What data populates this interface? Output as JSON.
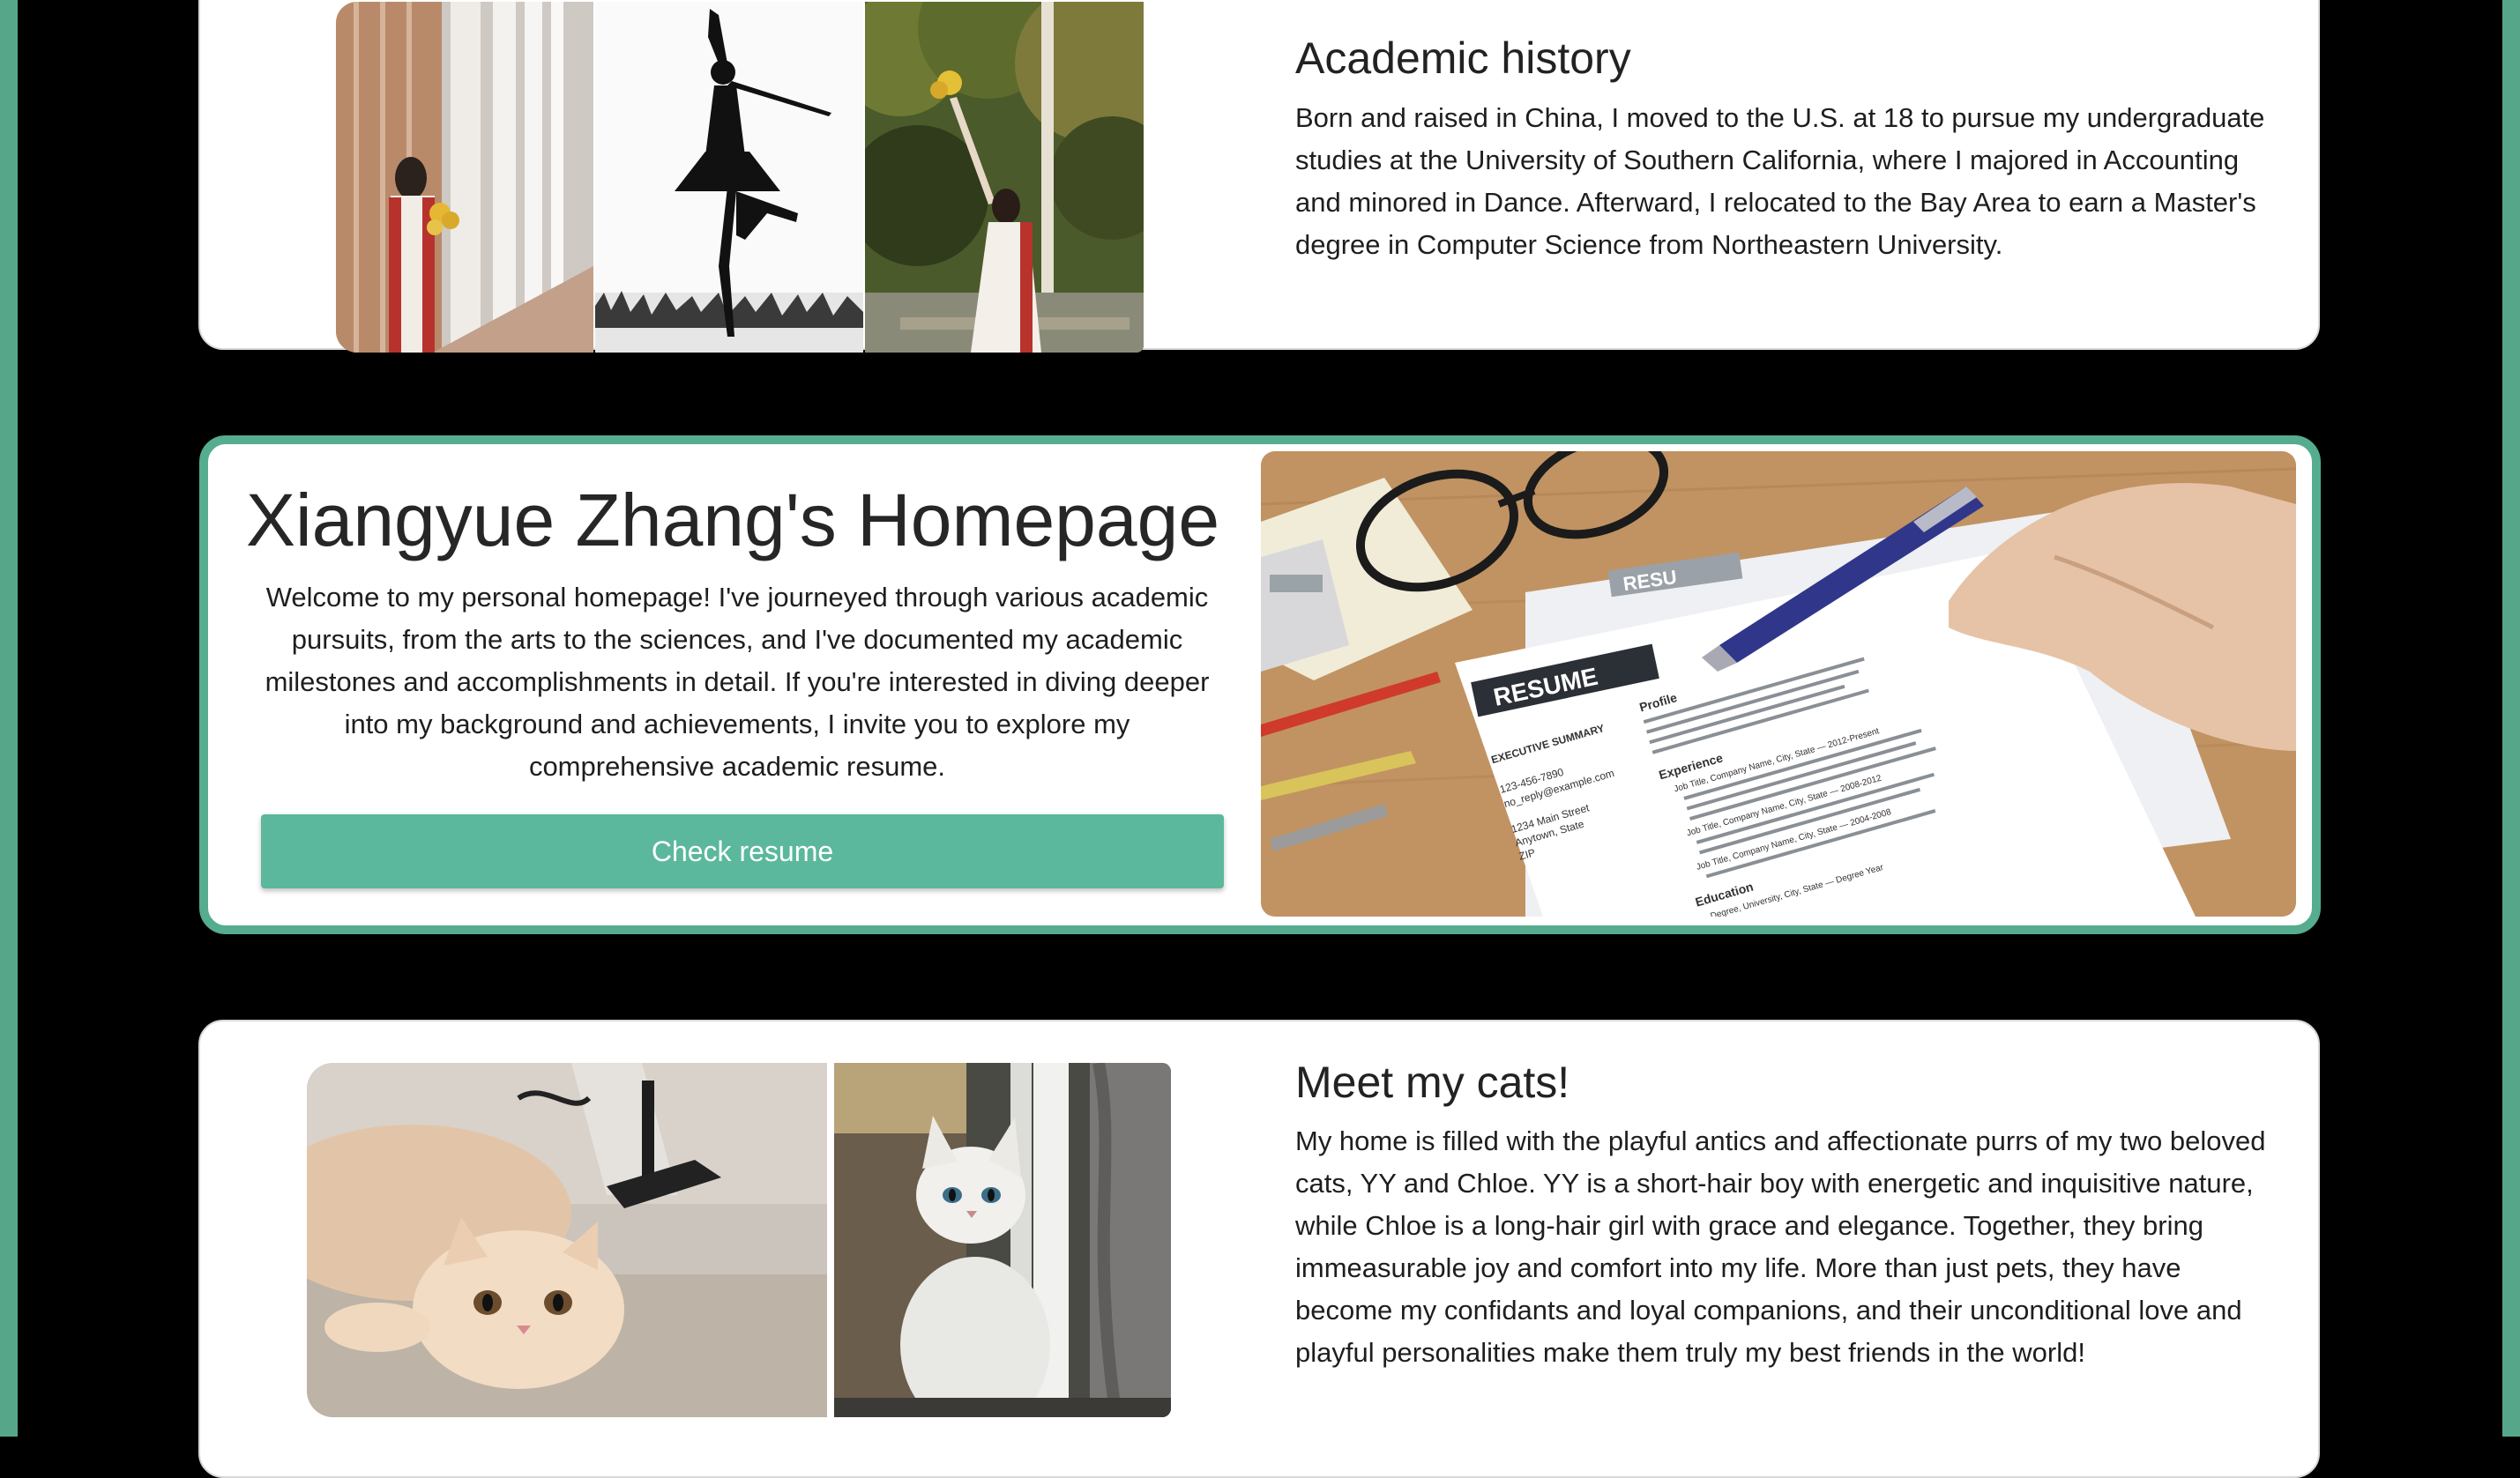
{
  "colors": {
    "accent": "#56ac8f",
    "button": "#5bb89c",
    "page_background": "#000000",
    "card_background": "#ffffff"
  },
  "academic": {
    "heading": "Academic history",
    "text": "Born and raised in China, I moved to the U.S. at 18 to pursue my undergraduate studies at the University of Southern California, where I majored in Accounting and minored in Dance. Afterward, I relocated to the Bay Area to earn a Master's degree in Computer Science from Northeastern University."
  },
  "hero": {
    "title": "Xiangyue Zhang's Homepage",
    "text": "Welcome to my personal homepage! I've journeyed through various academic pursuits, from the arts to the sciences, and I've documented my academic milestones and accomplishments in detail. If you're interested in diving deeper into my background and achievements, I invite you to explore my comprehensive academic resume.",
    "button_label": "Check resume",
    "resume_image": {
      "resume_heading": "RESUME",
      "executive_summary": "EXECUTIVE SUMMARY",
      "profile": "Profile",
      "experience": "Experience",
      "phone": "123-456-7890",
      "email": "no_reply@example.com",
      "address_line1": "1234 Main Street",
      "address_line2": "Anytown, State",
      "address_line3": "ZIP",
      "job_1": "Job Title, Company Name, City, State — 2012-Present",
      "job_2": "Job Title, Company Name, City, State — 2008-2012",
      "job_3": "Job Title, Company Name, City, State — 2004-2008",
      "education": "Education",
      "degree": "Degree, University, City, State — Degree Year",
      "back_sheet_heading": "RESU"
    }
  },
  "cats": {
    "heading": "Meet my cats!",
    "text": "My home is filled with the playful antics and affectionate purrs of my two beloved cats, YY and Chloe. YY is a short-hair boy with energetic and inquisitive nature, while Chloe is a long-hair girl with grace and elegance. Together, they bring immeasurable joy and comfort into my life. More than just pets, they have become my confidants and loyal companions, and their unconditional love and playful personalities make them truly my best friends in the world!"
  }
}
